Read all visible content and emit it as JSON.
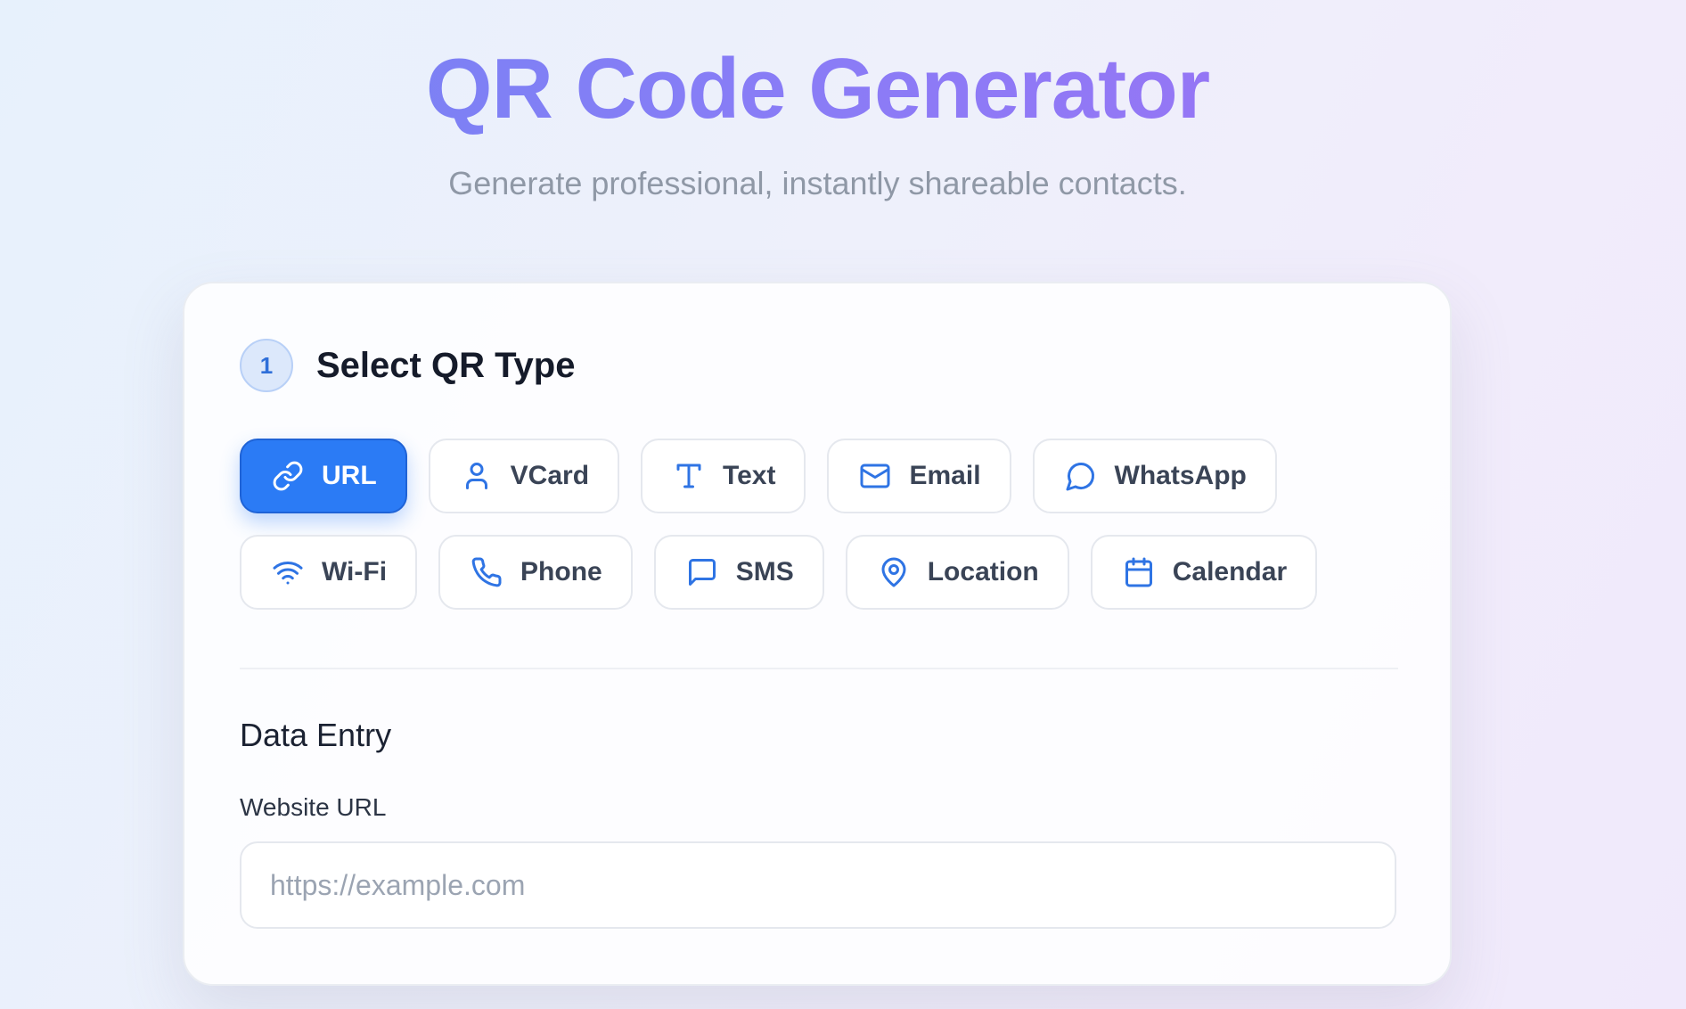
{
  "header": {
    "title": "QR Code Generator",
    "subtitle": "Generate professional, instantly shareable contacts."
  },
  "step": {
    "number": "1",
    "title": "Select QR Type"
  },
  "qr_types": {
    "selected": "URL",
    "items": [
      {
        "label": "URL",
        "icon": "link-icon"
      },
      {
        "label": "VCard",
        "icon": "user-icon"
      },
      {
        "label": "Text",
        "icon": "text-icon"
      },
      {
        "label": "Email",
        "icon": "mail-icon"
      },
      {
        "label": "WhatsApp",
        "icon": "chat-bubble-icon"
      },
      {
        "label": "Wi-Fi",
        "icon": "wifi-icon"
      },
      {
        "label": "Phone",
        "icon": "phone-icon"
      },
      {
        "label": "SMS",
        "icon": "message-icon"
      },
      {
        "label": "Location",
        "icon": "map-pin-icon"
      },
      {
        "label": "Calendar",
        "icon": "calendar-icon"
      }
    ]
  },
  "data_entry": {
    "title": "Data Entry",
    "field_label": "Website URL",
    "placeholder": "https://example.com",
    "value": ""
  },
  "colors": {
    "accent": "#2b7bf5",
    "icon": "#2f74e4",
    "title_gradient_start": "#6f86f3",
    "title_gradient_end": "#a070f4"
  }
}
